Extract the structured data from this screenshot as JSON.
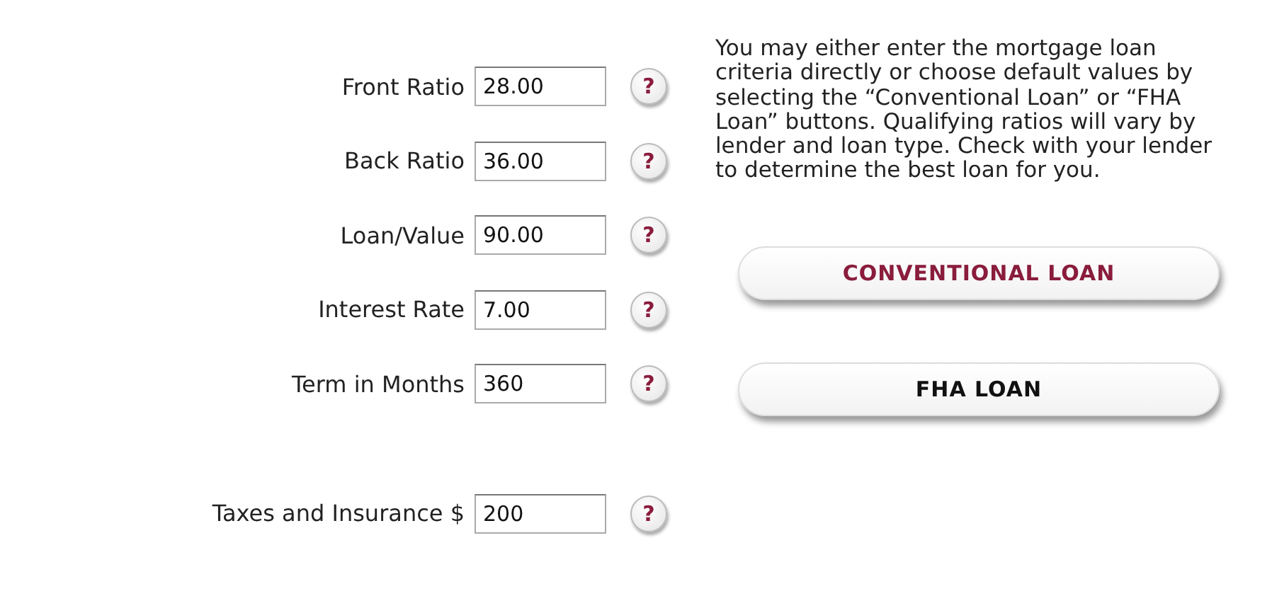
{
  "fields": [
    {
      "label": "Front Ratio",
      "value": "28.00"
    },
    {
      "label": "Back Ratio",
      "value": "36.00"
    },
    {
      "label": "Loan/Value",
      "value": "90.00"
    },
    {
      "label": "Interest Rate",
      "value": "7.00"
    },
    {
      "label": "Term in Months",
      "value": "360"
    },
    {
      "label": "Taxes and Insurance $",
      "value": "200"
    }
  ],
  "help_icon": "?",
  "instructions": "You may either enter the mortgage loan criteria directly or choose default values by selecting the “Conventional Loan” or “FHA Loan” buttons. Qualifying ratios will vary by lender and loan type. Check with your lender to determine the best loan for you.",
  "buttons": [
    {
      "label": "CONVENTIONAL LOAN",
      "color": "#8a1c3c"
    },
    {
      "label": "FHA LOAN",
      "color": "#111111"
    }
  ]
}
